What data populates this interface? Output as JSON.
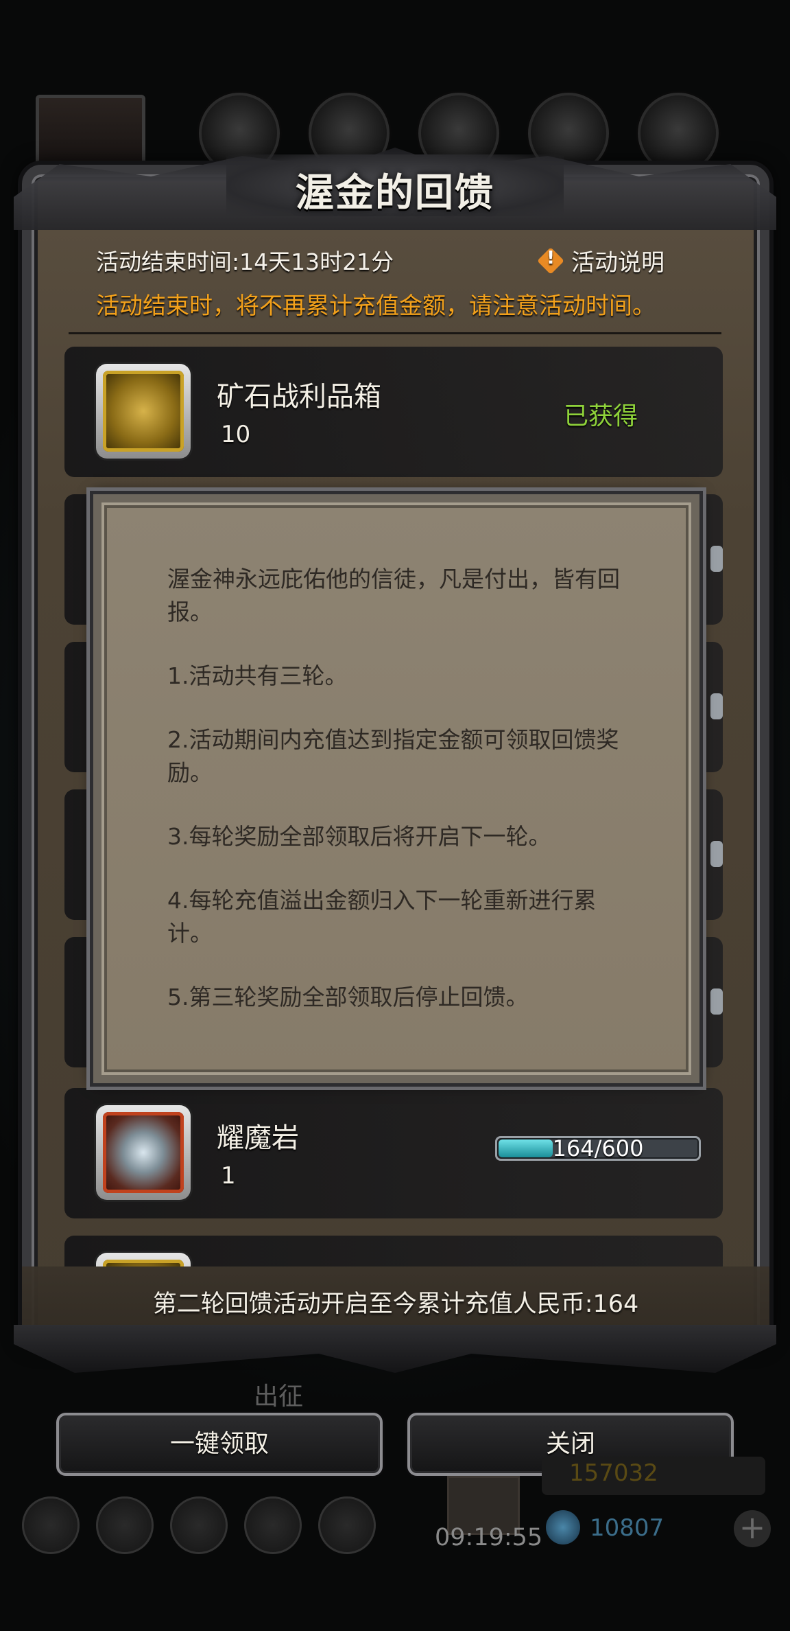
{
  "title": "渥金的回馈",
  "header": {
    "end_time": "活动结束时间:14天13时21分",
    "notice_link": "活动说明",
    "warning": "活动结束时，将不再累计充值金额，请注意活动时间。"
  },
  "rewards": [
    {
      "name": "矿石战利品箱",
      "count": "10",
      "status": "已获得"
    },
    {
      "name": "耀魔岩",
      "count": "1",
      "progress_text": "164/600",
      "progress": 0.27
    }
  ],
  "popup": {
    "paragraphs": [
      "渥金神永远庇佑他的信徒，凡是付出，皆有回报。",
      "1.活动共有三轮。",
      "2.活动期间内充值达到指定金额可领取回馈奖励。",
      "3.每轮奖励全部领取后将开启下一轮。",
      "4.每轮充值溢出金额归入下一轮重新进行累计。",
      "5.第三轮奖励全部领取后停止回馈。"
    ]
  },
  "total_recharge": "第二轮回馈活动开启至今累计充值人民币:164",
  "under_label": "出征",
  "buttons": {
    "claim_all": "一键领取",
    "close": "关闭"
  },
  "hud": {
    "clock": "09:19:55",
    "gold": "157032",
    "gems": "10807"
  },
  "icons": {
    "notice": "warning-diamond-icon",
    "item1": "treasure-chest-icon",
    "item2": "crystal-ore-icon"
  },
  "colors": {
    "warning_text": "#f3a11b",
    "obtained_text": "#8fd33a",
    "progress_fill": "#2fb8c2"
  }
}
